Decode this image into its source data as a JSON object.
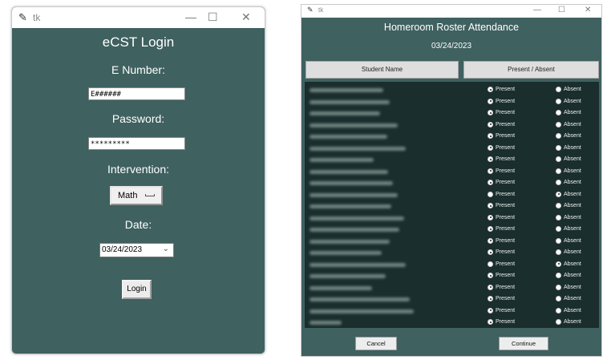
{
  "login_window": {
    "title": "tk",
    "controls": {
      "minimize": "—",
      "maximize": "☐",
      "close": "✕"
    },
    "heading": "eCST Login",
    "enumber_label": "E Number:",
    "enumber_value": "E######",
    "password_label": "Password:",
    "password_value": "*********",
    "intervention_label": "Intervention:",
    "intervention_value": "Math",
    "date_label": "Date:",
    "date_value": "03/24/2023",
    "login_button": "Login"
  },
  "roster_window": {
    "title": "tk",
    "controls": {
      "minimize": "—",
      "maximize": "☐",
      "close": "✕"
    },
    "heading": "Homeroom Roster Attendance",
    "date": "03/24/2023",
    "columns": [
      "Student Name",
      "Present / Absent"
    ],
    "present_label": "Present",
    "absent_label": "Absent",
    "rows": [
      {
        "status": "present"
      },
      {
        "status": "present"
      },
      {
        "status": "present"
      },
      {
        "status": "present"
      },
      {
        "status": "present"
      },
      {
        "status": "present"
      },
      {
        "status": "present"
      },
      {
        "status": "present"
      },
      {
        "status": "present"
      },
      {
        "status": "absent"
      },
      {
        "status": "present"
      },
      {
        "status": "present"
      },
      {
        "status": "present"
      },
      {
        "status": "present"
      },
      {
        "status": "present"
      },
      {
        "status": "absent"
      },
      {
        "status": "present"
      },
      {
        "status": "present"
      },
      {
        "status": "present"
      },
      {
        "status": "present"
      },
      {
        "status": "present"
      }
    ],
    "cancel_button": "Cancel",
    "continue_button": "Continue"
  }
}
